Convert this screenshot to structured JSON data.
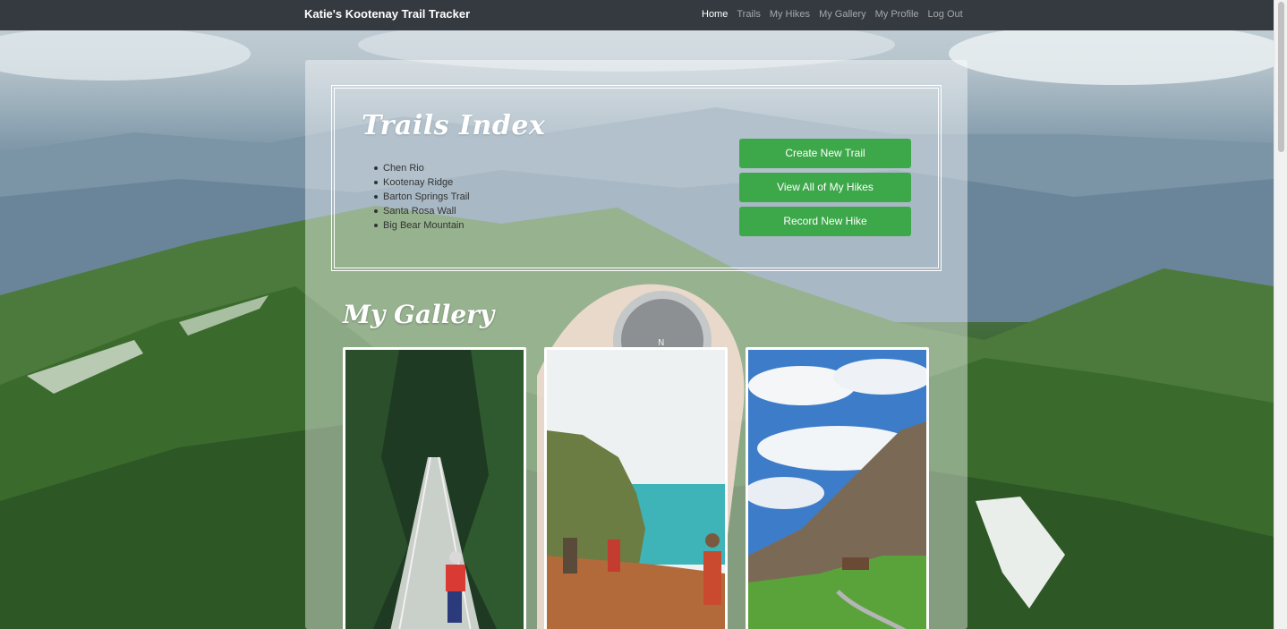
{
  "navbar": {
    "brand": "Katie's Kootenay Trail Tracker",
    "links": [
      {
        "label": "Home",
        "active": true
      },
      {
        "label": "Trails",
        "active": false
      },
      {
        "label": "My Hikes",
        "active": false
      },
      {
        "label": "My Gallery",
        "active": false
      },
      {
        "label": "My Profile",
        "active": false
      },
      {
        "label": "Log Out",
        "active": false
      }
    ]
  },
  "trails_index": {
    "title": "Trails Index",
    "trails": [
      "Chen Rio",
      "Kootenay Ridge",
      "Barton Springs Trail",
      "Santa Rosa Wall",
      "Big Bear Mountain"
    ]
  },
  "actions": {
    "create_trail": "Create New Trail",
    "view_hikes": "View All of My Hikes",
    "record_hike": "Record New Hike"
  },
  "gallery": {
    "title": "My Gallery"
  },
  "colors": {
    "navbar": "#343a40",
    "button": "#3da84a"
  }
}
